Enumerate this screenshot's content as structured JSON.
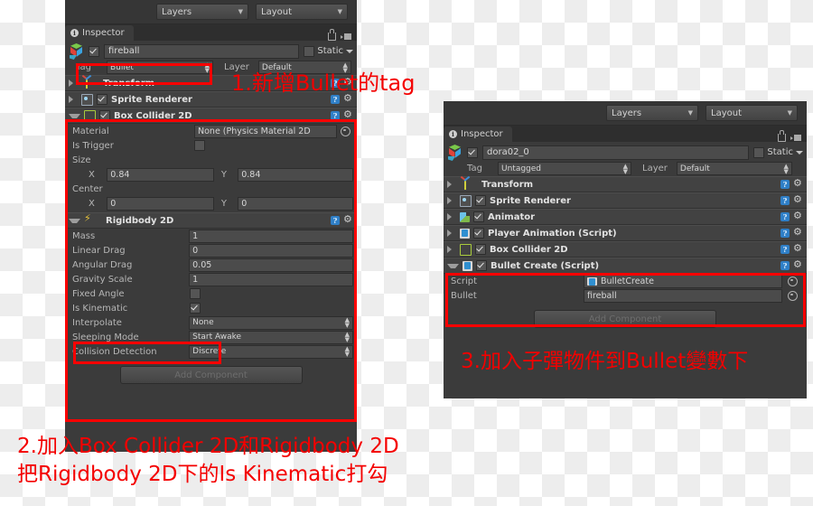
{
  "left_panel": {
    "toolbar": {
      "layers_button": "Layers",
      "layout_button": "Layout"
    },
    "tab": {
      "label": "Inspector",
      "badge": "i"
    },
    "object": {
      "name": "fireball",
      "enabled_checkbox": "checked",
      "static_label": "Static"
    },
    "tag_row": {
      "tag_label": "Tag",
      "tag_value": "Bullet",
      "layer_label": "Layer",
      "layer_value": "Default"
    },
    "components": [
      {
        "icon": "transform-icon",
        "title": "Transform",
        "has_checkbox": false,
        "expanded": false
      },
      {
        "icon": "sprite-renderer-icon",
        "title": "Sprite Renderer",
        "has_checkbox": true,
        "expanded": false
      },
      {
        "icon": "box-collider-2d-icon",
        "title": "Box Collider 2D",
        "has_checkbox": true,
        "expanded": true
      },
      {
        "icon": "rigidbody-2d-icon",
        "title": "Rigidbody 2D",
        "has_checkbox": false,
        "expanded": true
      }
    ],
    "box_collider": {
      "material_label": "Material",
      "material_value": "None (Physics Material 2D",
      "is_trigger_label": "Is Trigger",
      "is_trigger_value": "unchecked",
      "size_label": "Size",
      "size_x_label": "X",
      "size_x_value": "0.84",
      "size_y_label": "Y",
      "size_y_value": "0.84",
      "center_label": "Center",
      "center_x_label": "X",
      "center_x_value": "0",
      "center_y_label": "Y",
      "center_y_value": "0"
    },
    "rigidbody": {
      "mass_label": "Mass",
      "mass_value": "1",
      "linear_drag_label": "Linear Drag",
      "linear_drag_value": "0",
      "angular_drag_label": "Angular Drag",
      "angular_drag_value": "0.05",
      "gravity_scale_label": "Gravity Scale",
      "gravity_scale_value": "1",
      "fixed_angle_label": "Fixed Angle",
      "fixed_angle_value": "unchecked",
      "is_kinematic_label": "Is Kinematic",
      "is_kinematic_value": "checked",
      "interpolate_label": "Interpolate",
      "interpolate_value": "None",
      "sleeping_mode_label": "Sleeping Mode",
      "sleeping_mode_value": "Start Awake",
      "collision_detection_label": "Collision Detection",
      "collision_detection_value": "Discrete"
    },
    "add_component_button": "Add Component"
  },
  "right_panel": {
    "toolbar": {
      "layers_button": "Layers",
      "layout_button": "Layout"
    },
    "tab": {
      "label": "Inspector",
      "badge": "i"
    },
    "object": {
      "name": "dora02_0",
      "enabled_checkbox": "checked",
      "static_label": "Static"
    },
    "tag_row": {
      "tag_label": "Tag",
      "tag_value": "Untagged",
      "layer_label": "Layer",
      "layer_value": "Default"
    },
    "components": [
      {
        "icon": "transform-icon",
        "title": "Transform",
        "has_checkbox": false
      },
      {
        "icon": "sprite-renderer-icon",
        "title": "Sprite Renderer",
        "has_checkbox": true
      },
      {
        "icon": "animator-icon",
        "title": "Animator",
        "has_checkbox": true
      },
      {
        "icon": "script-icon",
        "title": "Player Animation (Script)",
        "has_checkbox": true
      },
      {
        "icon": "box-collider-2d-icon",
        "title": "Box Collider 2D",
        "has_checkbox": true
      }
    ],
    "bullet_create": {
      "title": "Bullet Create (Script)",
      "script_label": "Script",
      "script_value": "BulletCreate",
      "bullet_label": "Bullet",
      "bullet_value": "fireball"
    },
    "add_component_button": "Add Component"
  },
  "annotations": {
    "step1": "1.新增Bullet的tag",
    "step2_line1": "2.加入Box Collider 2D和Rigidbody 2D",
    "step2_line2": "把Rigidbody 2D下的Is Kinematic打勾",
    "step3": "3.加入子彈物件到Bullet變數下"
  },
  "colors": {
    "annotation_red": "#f40000",
    "highlight_red": "#fe0000",
    "panel_bg": "#3b3b3b",
    "toolbar_bg": "#363636",
    "field_bg": "#4b4b4b"
  }
}
